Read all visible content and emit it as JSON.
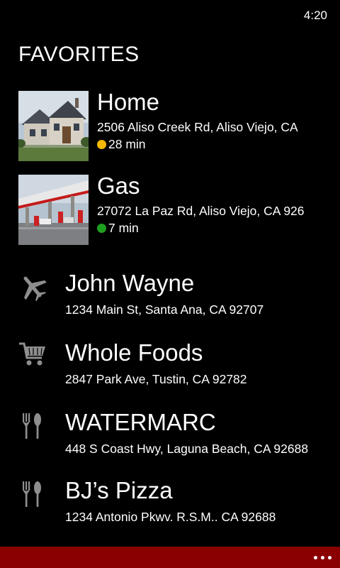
{
  "status": {
    "time": "4:20"
  },
  "page": {
    "title": "FAVORITES"
  },
  "favorites": [
    {
      "name": "Home",
      "address": "2506 Aliso Creek Rd, Aliso Viejo, CA",
      "eta": "28 min",
      "eta_color": "#f5b800",
      "image": "house-photo"
    },
    {
      "name": "Gas",
      "address": "27072 La Paz Rd, Aliso Viejo, CA 926",
      "eta": "7 min",
      "eta_color": "#1ea01e",
      "image": "gas-station-photo"
    },
    {
      "name": "John Wayne",
      "address": "1234 Main St, Santa Ana, CA 92707",
      "icon": "airplane-icon"
    },
    {
      "name": "Whole Foods",
      "address": "2847 Park Ave, Tustin, CA 92782",
      "icon": "shopping-cart-icon"
    },
    {
      "name": "WATERMARC",
      "address": "448 S Coast Hwy, Laguna Beach, CA 92688",
      "icon": "fork-spoon-icon"
    },
    {
      "name": "BJ’s Pizza",
      "address": "1234 Antonio Pkwv. R.S.M.. CA 92688",
      "icon": "fork-spoon-icon"
    }
  ],
  "app_bar": {
    "color": "#8a0000",
    "more_icon": "ellipsis-icon"
  }
}
